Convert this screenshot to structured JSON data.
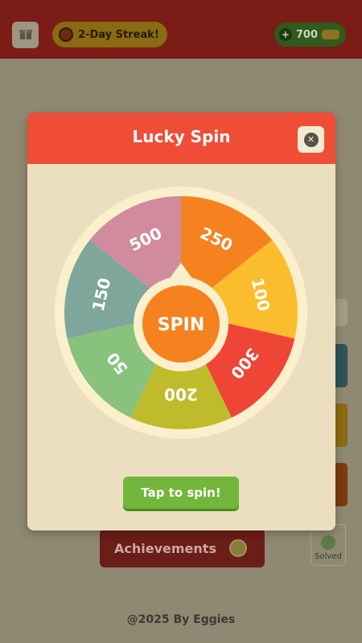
{
  "header": {
    "gift_icon": "gift-icon",
    "streak_label": "2-Day Streak!",
    "coins_value": "700"
  },
  "background": {
    "achievements_label": "Achievements",
    "solved_label": "Solved",
    "footer_text": "@2025 By Eggies"
  },
  "modal": {
    "title": "Lucky Spin",
    "spin_label": "SPIN",
    "tap_label": "Tap to spin!",
    "segments": [
      {
        "label": "250",
        "color": "#f5821f"
      },
      {
        "label": "100",
        "color": "#fbbd2e"
      },
      {
        "label": "300",
        "color": "#ef4537"
      },
      {
        "label": "200",
        "color": "#bfbc2c"
      },
      {
        "label": "50",
        "color": "#88c27d"
      },
      {
        "label": "150",
        "color": "#7ea69b"
      },
      {
        "label": "500",
        "color": "#d18b9e"
      }
    ],
    "colors": {
      "header": "#ef4d36",
      "body": "#ecdfbf",
      "wheel_rim": "#fbf0cc",
      "spin_button": "#f5821f",
      "tap_button": "#72b63c"
    }
  }
}
